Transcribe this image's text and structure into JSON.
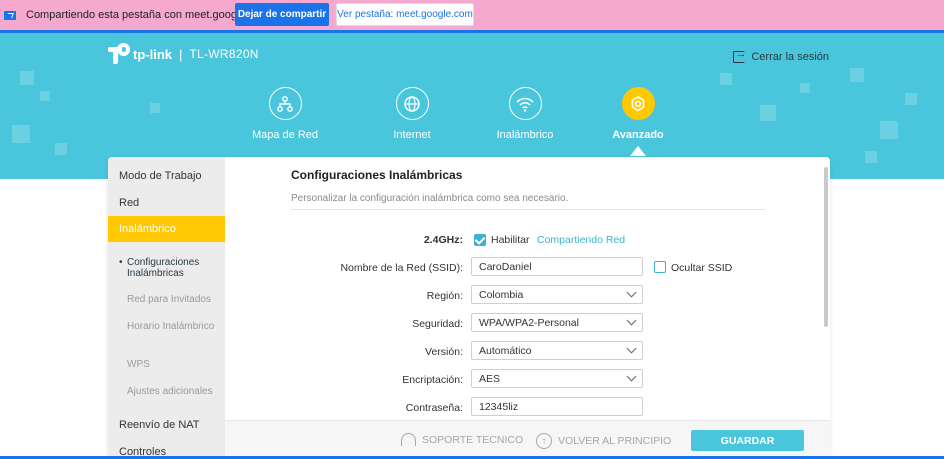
{
  "meet_bar": {
    "message": "Compartiendo esta pestaña con meet.google.com",
    "stop_label": "Dejar de compartir",
    "view_label": "Ver pestaña: meet.google.com"
  },
  "header": {
    "brand": "tp-link",
    "separator": "|",
    "model": "TL-WR820N",
    "logout_label": "Cerrar la sesión"
  },
  "nav": [
    {
      "label": "Mapa de Red",
      "icon": "network-map-icon"
    },
    {
      "label": "Internet",
      "icon": "globe-icon"
    },
    {
      "label": "Inalámbrico",
      "icon": "wifi-icon"
    },
    {
      "label": "Avanzado",
      "icon": "gear-icon",
      "active": true
    }
  ],
  "sidebar": {
    "items": [
      {
        "label": "Modo de Trabajo"
      },
      {
        "label": "Red"
      },
      {
        "label": "Inalámbrico",
        "active": true
      },
      {
        "label": "Reenvío de NAT"
      },
      {
        "label": "Controles"
      }
    ],
    "subitems": [
      {
        "label": "Configuraciones Inalámbricas",
        "current": true
      },
      {
        "label": "Red para Invitados"
      },
      {
        "label": "Horario Inalámbrico"
      },
      {
        "label": "WPS"
      },
      {
        "label": "Ajustes adicionales"
      }
    ]
  },
  "main": {
    "title": "Configuraciones Inalámbricas",
    "subtitle": "Personalizar la configuración inalámbrica como sea necesario.",
    "band_label": "2.4GHz:",
    "enable_label": "Habilitar",
    "enable_checked": true,
    "sharing_link": "Compartiendo Red",
    "ssid_label": "Nombre de la Red (SSID):",
    "ssid_value": "CaroDaniel",
    "hide_ssid_label": "Ocultar SSID",
    "hide_ssid_checked": false,
    "region_label": "Región:",
    "region_value": "Colombia",
    "security_label": "Seguridad:",
    "security_value": "WPA/WPA2-Personal",
    "version_label": "Versión:",
    "version_value": "Automático",
    "encryption_label": "Encriptación:",
    "encryption_value": "AES",
    "password_label": "Contraseña:",
    "password_value": "12345liz"
  },
  "footer": {
    "support_label": "SOPORTE TECNICO",
    "back_label": "VOLVER AL PRINCIPIO",
    "save_label": "GUARDAR"
  },
  "colors": {
    "header_bg": "#4ac6dc",
    "accent_yellow": "#ffc800",
    "accent_blue": "#3bb3ce",
    "meet_bar_bg": "#f5a9cf",
    "meet_button": "#1a73e8"
  }
}
